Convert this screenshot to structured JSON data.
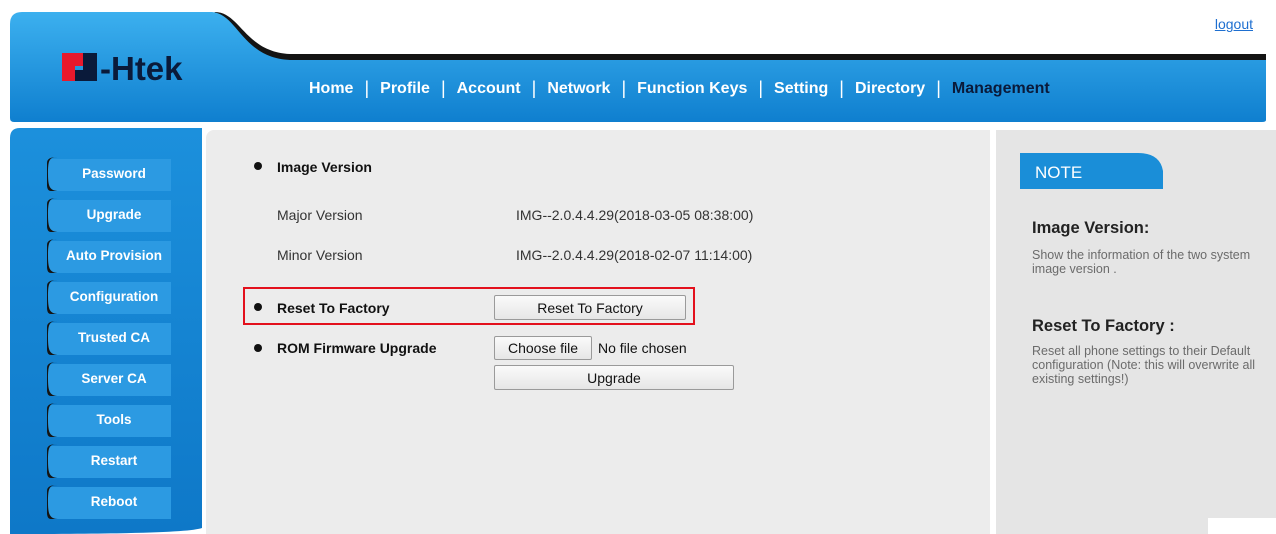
{
  "header": {
    "logo_text": "Htek",
    "logout": "logout",
    "nav": [
      {
        "label": "Home",
        "active": false
      },
      {
        "label": "Profile",
        "active": false
      },
      {
        "label": "Account",
        "active": false
      },
      {
        "label": "Network",
        "active": false
      },
      {
        "label": "Function Keys",
        "active": false
      },
      {
        "label": "Setting",
        "active": false
      },
      {
        "label": "Directory",
        "active": false
      },
      {
        "label": "Management",
        "active": true
      }
    ]
  },
  "sidebar": {
    "items": [
      {
        "label": "Password"
      },
      {
        "label": "Upgrade"
      },
      {
        "label": "Auto Provision"
      },
      {
        "label": "Configuration"
      },
      {
        "label": "Trusted CA"
      },
      {
        "label": "Server CA"
      },
      {
        "label": "Tools"
      },
      {
        "label": "Restart"
      },
      {
        "label": "Reboot"
      }
    ]
  },
  "main": {
    "image_version": {
      "title": "Image Version",
      "major_label": "Major Version",
      "major_value": "IMG--2.0.4.4.29(2018-03-05 08:38:00)",
      "minor_label": "Minor Version",
      "minor_value": "IMG--2.0.4.4.29(2018-02-07 11:14:00)"
    },
    "reset": {
      "title": "Reset To Factory",
      "button_label": "Reset To Factory"
    },
    "firmware": {
      "title": "ROM Firmware Upgrade",
      "choose_file_label": "Choose file",
      "no_file_text": "No file chosen",
      "upgrade_label": "Upgrade"
    }
  },
  "note": {
    "tab_label": "NOTE",
    "sections": [
      {
        "title": "Image Version:",
        "text": "Show the information of the two system image version ."
      },
      {
        "title": "Reset To Factory :",
        "text": "Reset all phone settings to their Default configuration (Note: this will overwrite all existing settings!)"
      }
    ]
  },
  "colors": {
    "brand_blue": "#1a8ed8",
    "header_dark": "#141414",
    "logo_red": "#e8192c",
    "highlight_red": "#e3101c",
    "link_blue": "#1e6fd0"
  }
}
